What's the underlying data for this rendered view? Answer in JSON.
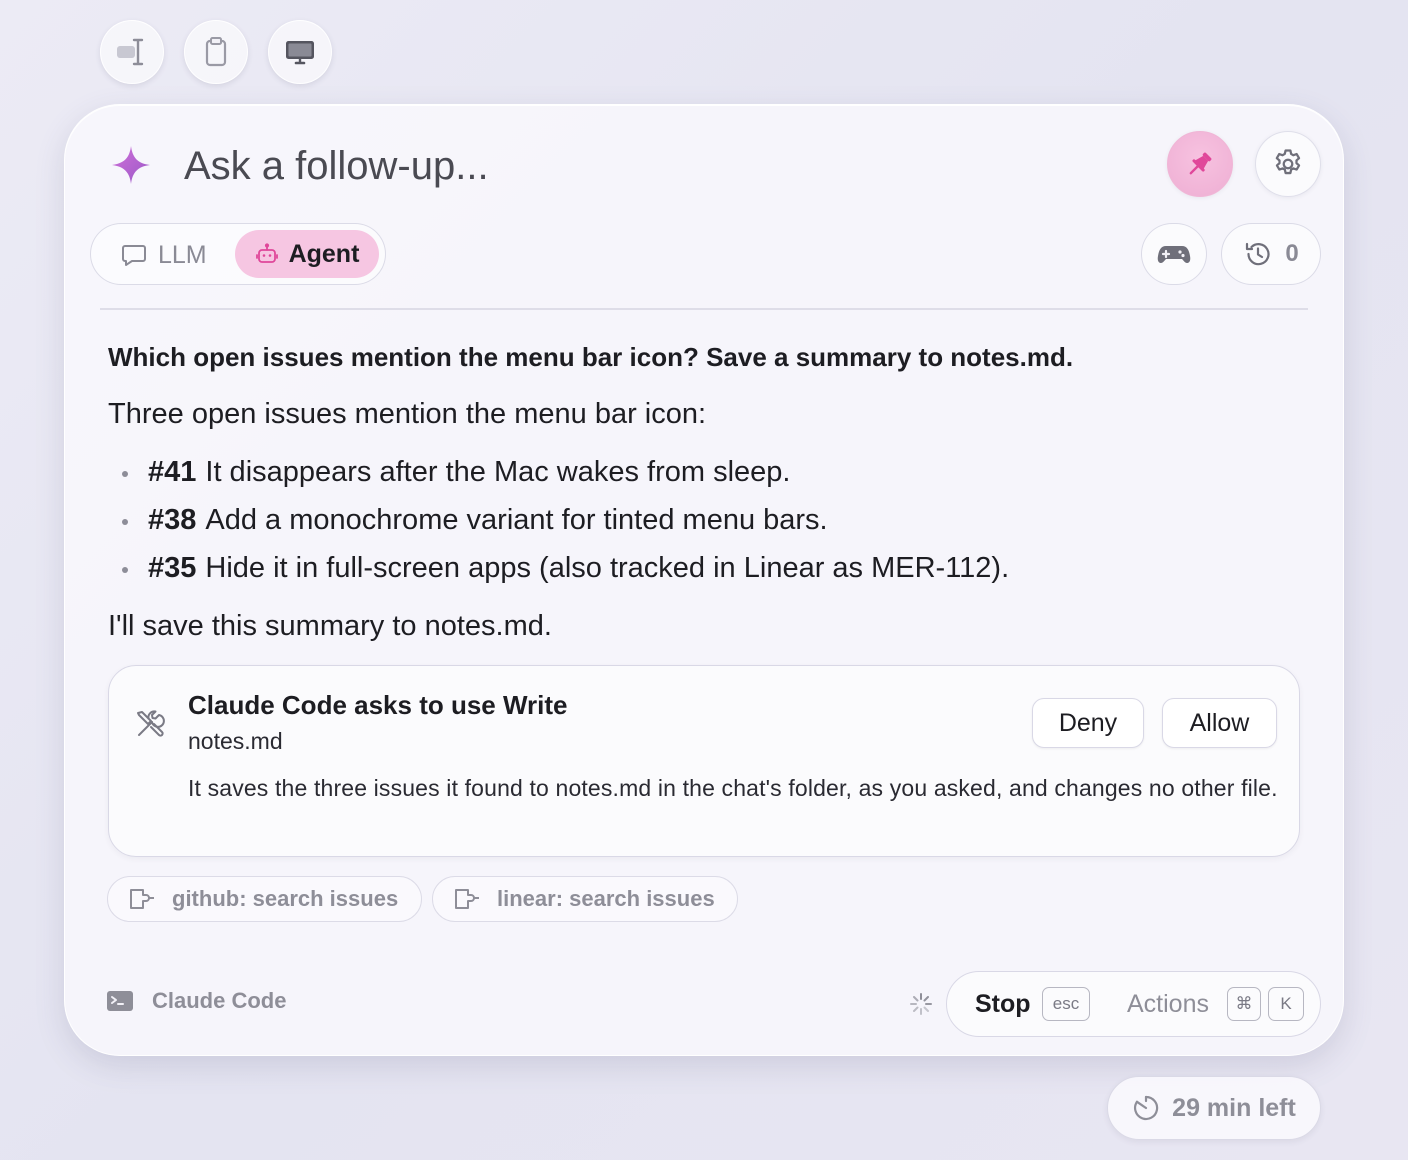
{
  "toolbar": {
    "icons": [
      "text-cursor-icon",
      "clipboard-icon",
      "monitor-icon"
    ]
  },
  "header": {
    "placeholder": "Ask a follow-up...",
    "pin_active_color": "#e0479a",
    "accent_color": "#c060c8"
  },
  "mode": {
    "llm_label": "LLM",
    "agent_label": "Agent",
    "selected": "Agent"
  },
  "history": {
    "count": "0"
  },
  "conversation": {
    "question": "Which open issues mention the menu bar icon? Save a summary to notes.md.",
    "intro": "Three open issues mention the menu bar icon:",
    "issues": [
      {
        "number": "#41",
        "text": "It disappears after the Mac wakes from sleep."
      },
      {
        "number": "#38",
        "text": "Add a monochrome variant for tinted menu bars."
      },
      {
        "number": "#35",
        "text": "Hide it in full-screen apps (also tracked in Linear as MER-112)."
      }
    ],
    "outro": "I'll save this summary to notes.md."
  },
  "permission": {
    "title": "Claude Code asks to use Write",
    "file": "notes.md",
    "description": "It saves the three issues it found to notes.md in the chat's folder, as you asked, and changes no other file.",
    "deny_label": "Deny",
    "allow_label": "Allow"
  },
  "tools": [
    {
      "label": "github: search issues"
    },
    {
      "label": "linear: search issues"
    }
  ],
  "footer": {
    "agent_name": "Claude Code",
    "stop_label": "Stop",
    "stop_key": "esc",
    "actions_label": "Actions",
    "actions_keys": [
      "⌘",
      "K"
    ]
  },
  "session": {
    "time_left": "29 min left"
  }
}
